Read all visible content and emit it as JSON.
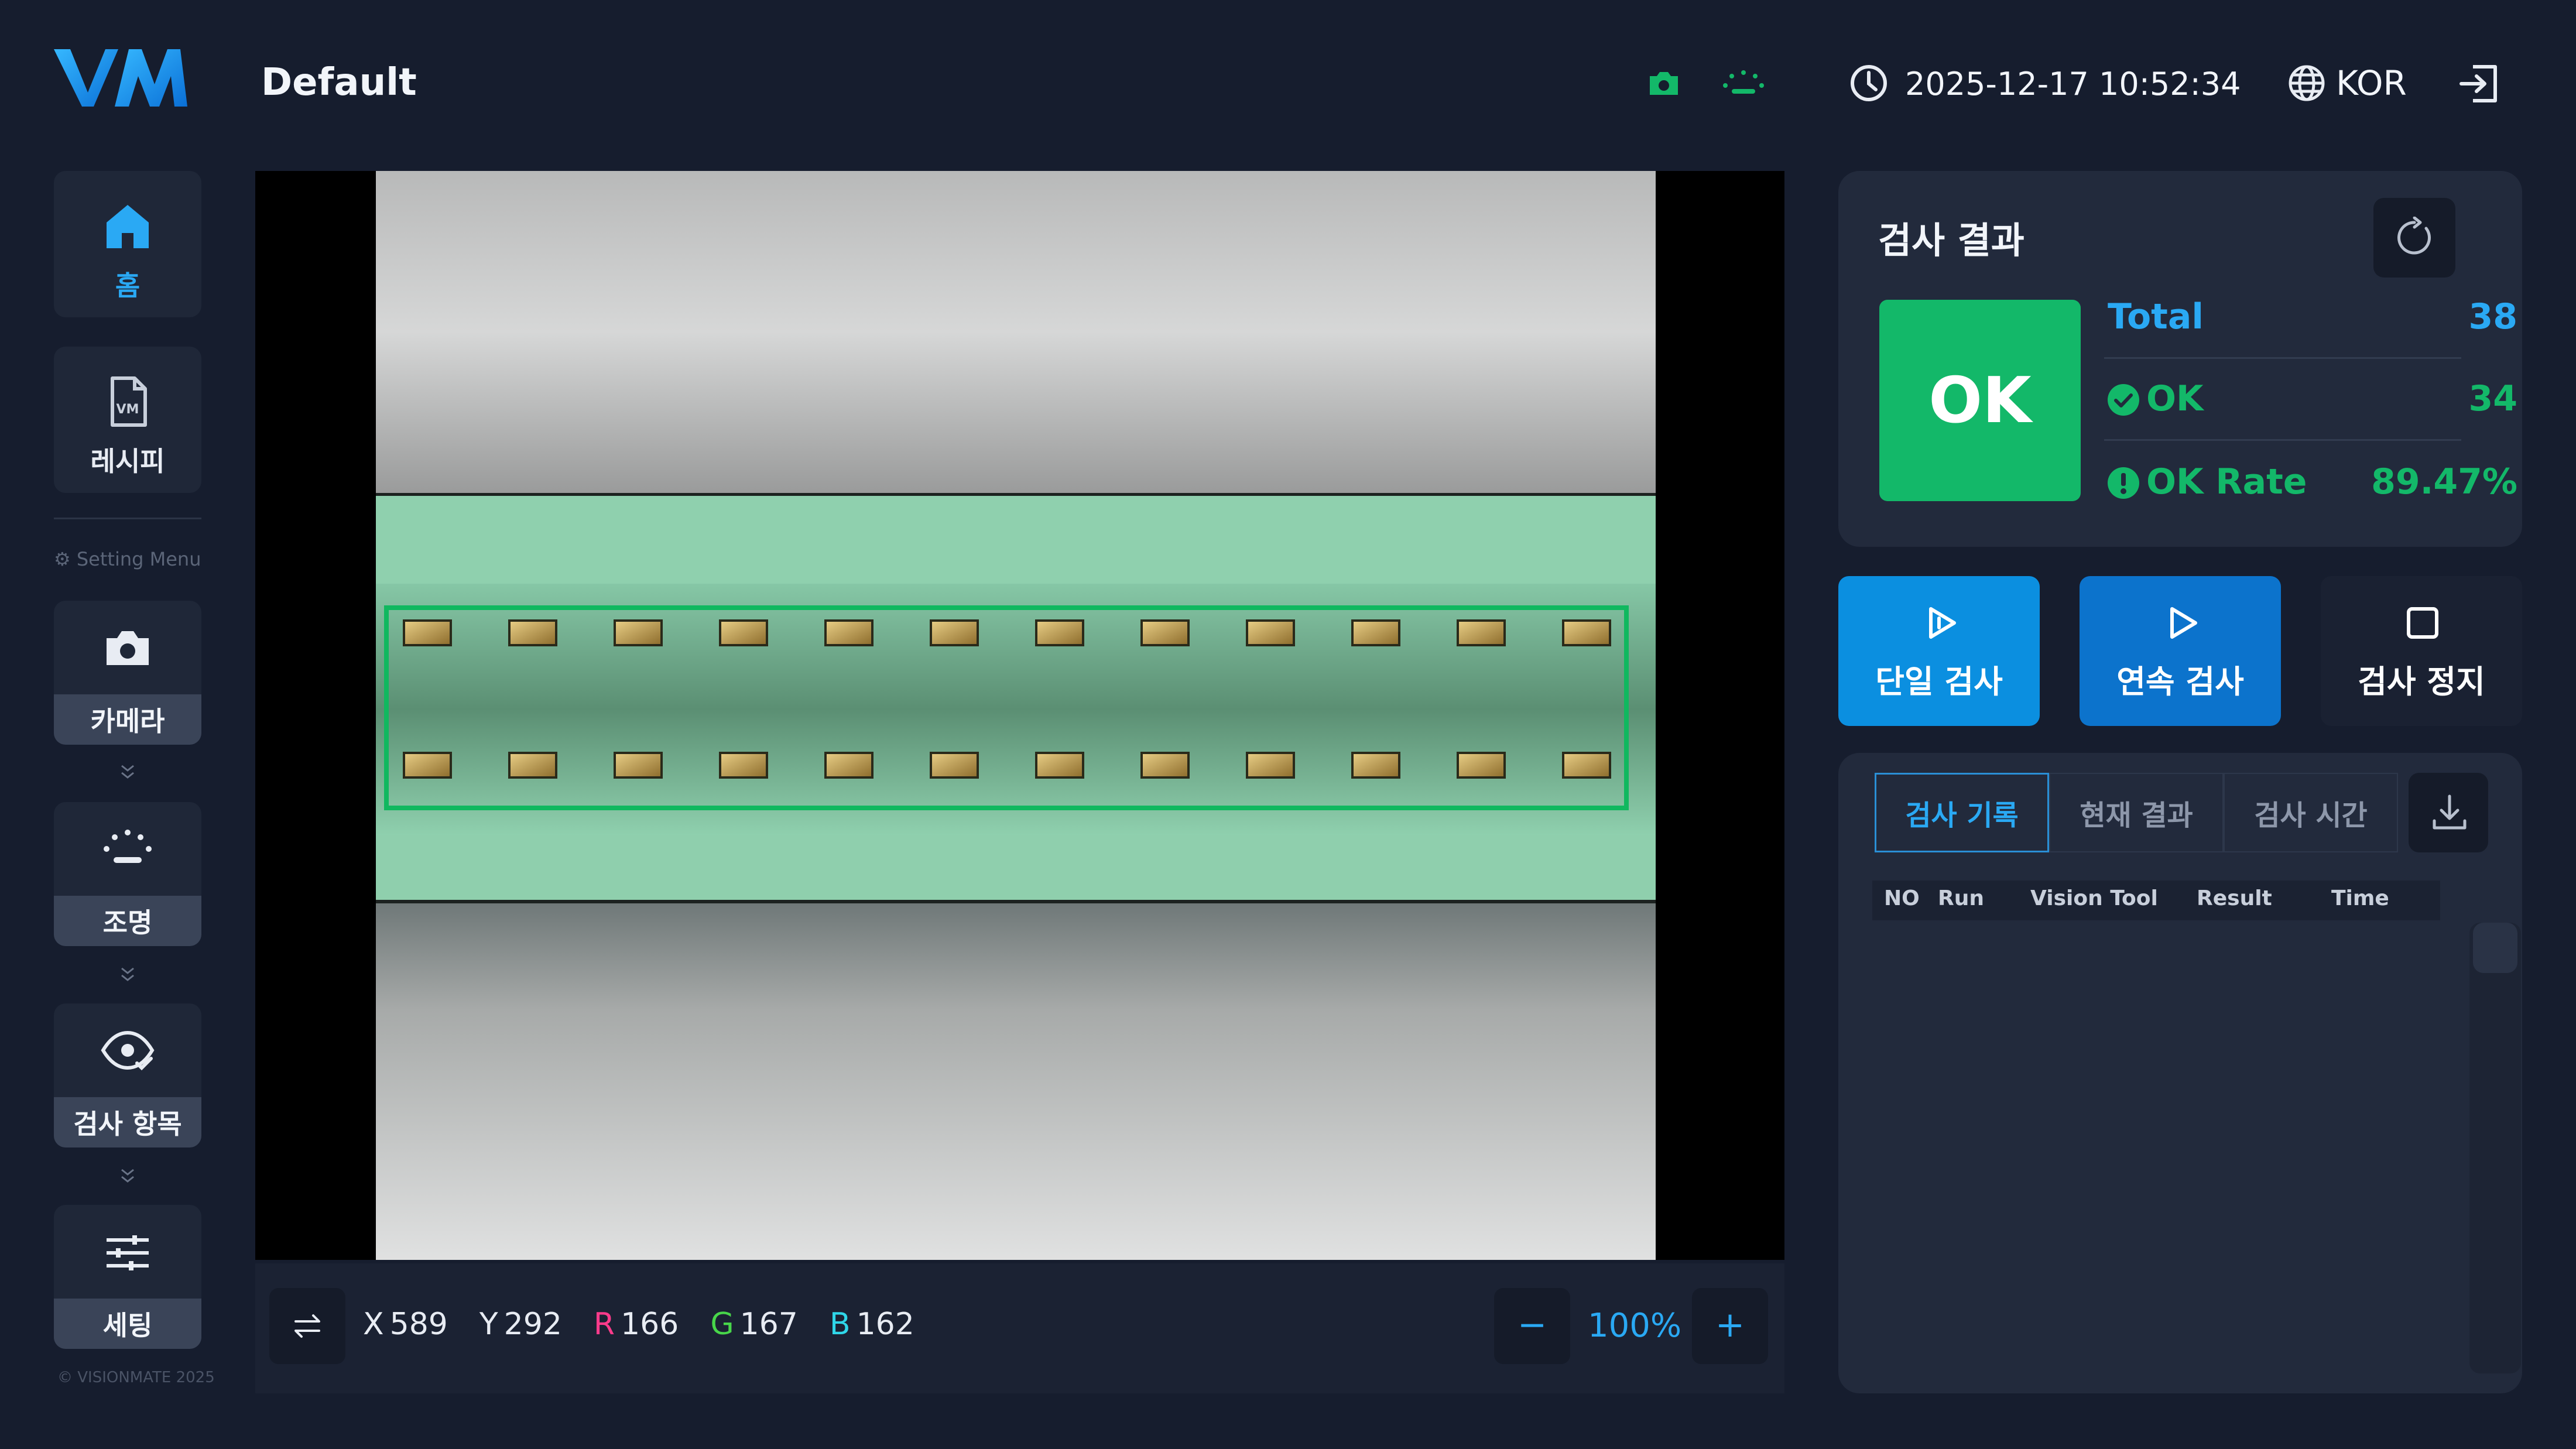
{
  "header": {
    "title": "Default",
    "datetime": "2025-12-17 10:52:34",
    "language": "KOR",
    "status_colors": {
      "camera": "#13b869",
      "light": "#13b869"
    }
  },
  "sidebar": {
    "items": [
      {
        "label": "홈",
        "icon": "home-icon",
        "active": true
      },
      {
        "label": "레시피",
        "icon": "recipe-file-icon"
      }
    ],
    "setting_menu_label": "Setting Menu",
    "settings": [
      {
        "label": "카메라",
        "icon": "camera-icon"
      },
      {
        "label": "조명",
        "icon": "light-icon"
      },
      {
        "label": "검사 항목",
        "icon": "eye-check-icon"
      },
      {
        "label": "세팅",
        "icon": "sliders-icon"
      }
    ],
    "copyright": "© VISIONMATE 2025"
  },
  "viewer": {
    "readout": {
      "x_label": "X",
      "x": "589",
      "y_label": "Y",
      "y": "292",
      "r_label": "R",
      "r": "166",
      "g_label": "G",
      "g": "167",
      "b_label": "B",
      "b": "162"
    },
    "zoom": "100%",
    "zoom_out_label": "−",
    "zoom_in_label": "+"
  },
  "results": {
    "title": "검사 결과",
    "status": "OK",
    "total_label": "Total",
    "total_value": "38",
    "ok_label": "OK",
    "ok_value": "34",
    "rate_label": "OK Rate",
    "rate_value": "89.47%",
    "colors": {
      "ok": "#13b869",
      "accent": "#2aa9f4"
    }
  },
  "actions": {
    "single": "단일 검사",
    "continuous": "연속 검사",
    "stop": "검사 정지"
  },
  "log": {
    "tabs": [
      "검사 기록",
      "현재 결과",
      "검사 시간"
    ],
    "columns": [
      "NO",
      "Run",
      "Vision Tool",
      "Result",
      "Time"
    ]
  }
}
